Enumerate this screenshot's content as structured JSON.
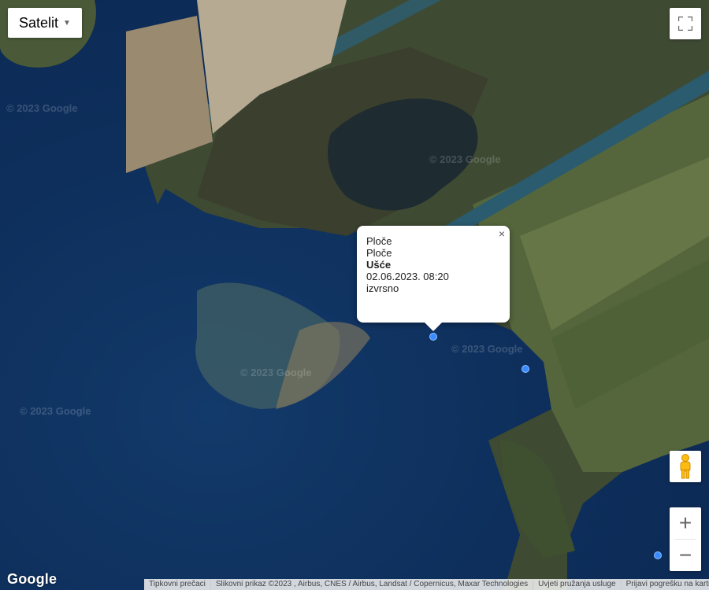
{
  "map_type": {
    "label": "Satelit"
  },
  "popup": {
    "line1": "Ploče",
    "line2": "Ploče",
    "line3": "Ušće",
    "line4": "02.06.2023. 08:20",
    "line5": "izvrsno",
    "close": "×"
  },
  "watermark": "© 2023 Google",
  "logo": "Google",
  "footer": {
    "shortcuts": "Tipkovni prečaci",
    "imagery": "Slikovni prikaz ©2023 , Airbus, CNES / Airbus, Landsat / Copernicus, Maxar Technologies",
    "terms": "Uvjeti pružanja usluge",
    "report": "Prijavi pogrešku na karti"
  },
  "controls": {
    "zoom_in": "+",
    "zoom_out": "−",
    "fullscreen_icon": "fullscreen-icon",
    "pegman_icon": "pegman-icon"
  },
  "colors": {
    "marker": "#3b8cff",
    "water": "#0e2f5c",
    "land": "#5a6b3c"
  }
}
